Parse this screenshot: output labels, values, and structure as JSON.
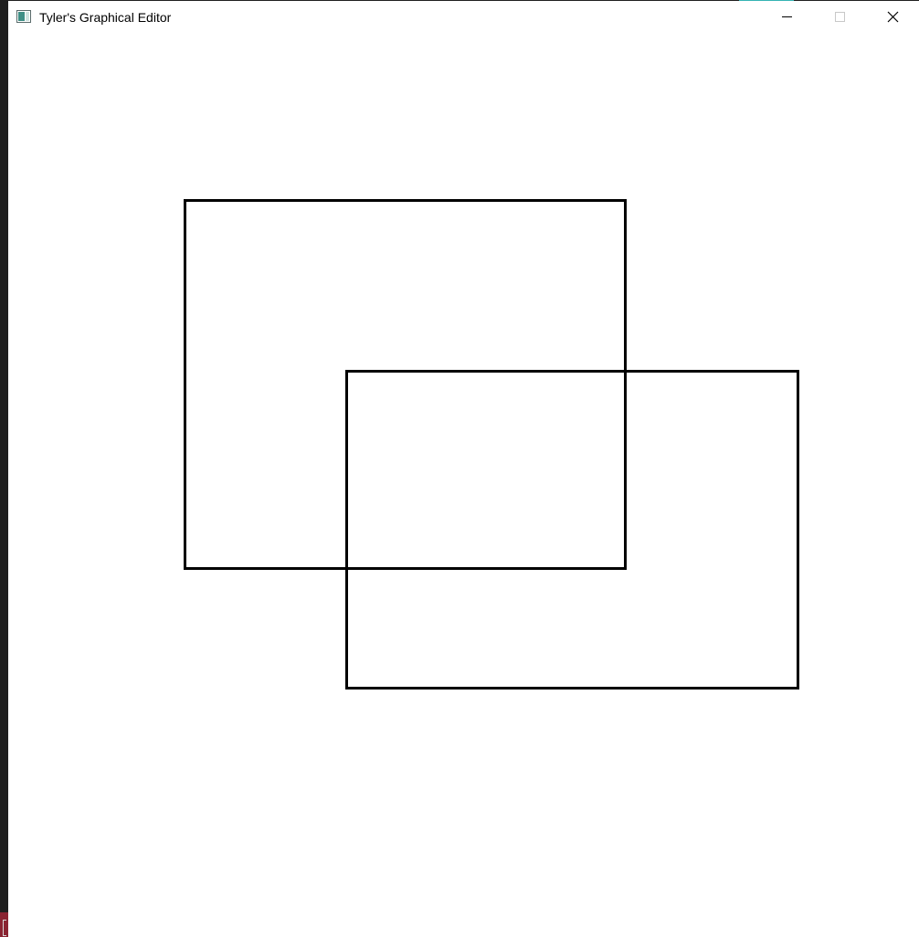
{
  "window": {
    "title": "Tyler's Graphical Editor",
    "icon": "app-window-icon"
  },
  "controls": {
    "minimize_icon": "minimize-icon",
    "maximize_icon": "maximize-icon",
    "close_icon": "close-icon"
  },
  "canvas": {
    "background": "#ffffff",
    "stroke_color": "#000000",
    "shapes": [
      {
        "type": "rectangle"
      },
      {
        "type": "rectangle"
      }
    ]
  }
}
